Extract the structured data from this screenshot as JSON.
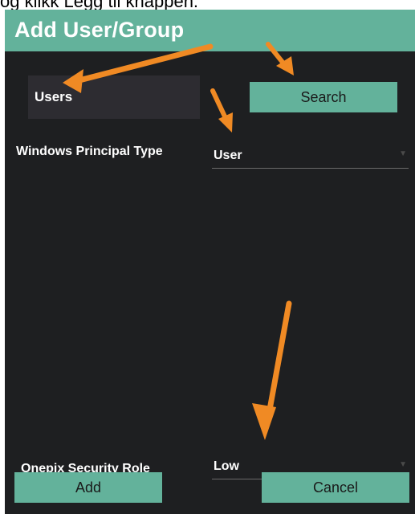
{
  "caption": "og klikk Legg til knappen.",
  "dialog": {
    "title": "Add User/Group",
    "search_value": "Users",
    "search_button": "Search",
    "principal_type_label": "Windows Principal Type",
    "principal_type_value": "User",
    "security_role_label": "Onepix Security Role",
    "security_role_value": "Low",
    "add_button": "Add",
    "cancel_button": "Cancel"
  },
  "colors": {
    "accent": "#63b29b",
    "background": "#1e1f21",
    "arrow": "#f08a24"
  }
}
